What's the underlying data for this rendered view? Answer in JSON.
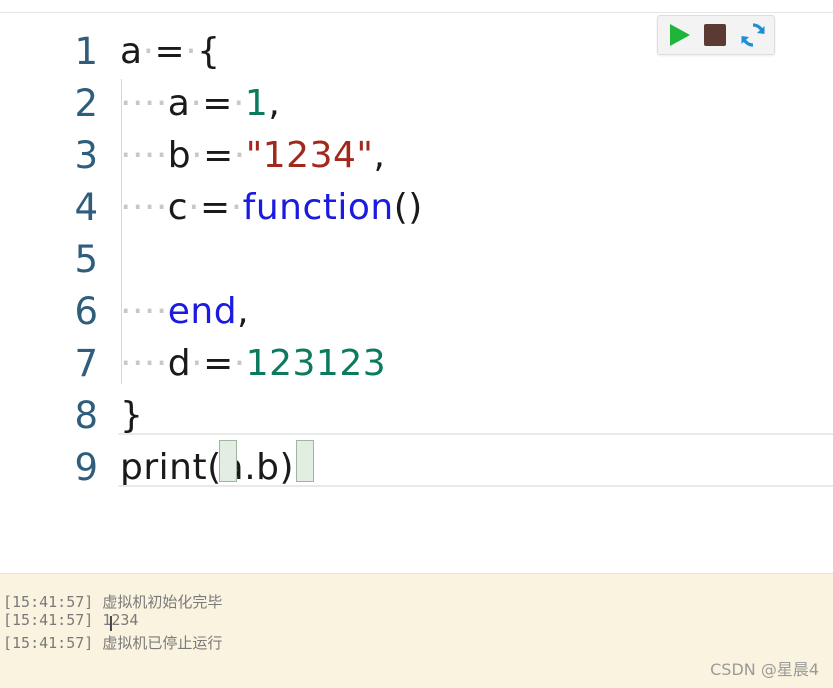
{
  "editor": {
    "line_numbers": [
      "1",
      "2",
      "3",
      "4",
      "5",
      "6",
      "7",
      "8",
      "9"
    ],
    "lines": [
      [
        {
          "t": "a",
          "c": ""
        },
        {
          "t": "·",
          "c": "ws"
        },
        {
          "t": "=",
          "c": ""
        },
        {
          "t": "·",
          "c": "ws"
        },
        {
          "t": "{",
          "c": ""
        }
      ],
      [
        {
          "t": "····",
          "c": "ws"
        },
        {
          "t": "a",
          "c": ""
        },
        {
          "t": "·",
          "c": "ws"
        },
        {
          "t": "=",
          "c": ""
        },
        {
          "t": "·",
          "c": "ws"
        },
        {
          "t": "1",
          "c": "num"
        },
        {
          "t": ",",
          "c": ""
        }
      ],
      [
        {
          "t": "····",
          "c": "ws"
        },
        {
          "t": "b",
          "c": ""
        },
        {
          "t": "·",
          "c": "ws"
        },
        {
          "t": "=",
          "c": ""
        },
        {
          "t": "·",
          "c": "ws"
        },
        {
          "t": "\"1234\"",
          "c": "str"
        },
        {
          "t": ",",
          "c": ""
        }
      ],
      [
        {
          "t": "····",
          "c": "ws"
        },
        {
          "t": "c",
          "c": ""
        },
        {
          "t": "·",
          "c": "ws"
        },
        {
          "t": "=",
          "c": ""
        },
        {
          "t": "·",
          "c": "ws"
        },
        {
          "t": "function",
          "c": "kw"
        },
        {
          "t": "()",
          "c": ""
        }
      ],
      [],
      [
        {
          "t": "····",
          "c": "ws"
        },
        {
          "t": "end",
          "c": "kw"
        },
        {
          "t": ",",
          "c": ""
        }
      ],
      [
        {
          "t": "····",
          "c": "ws"
        },
        {
          "t": "d",
          "c": ""
        },
        {
          "t": "·",
          "c": "ws"
        },
        {
          "t": "=",
          "c": ""
        },
        {
          "t": "·",
          "c": "ws"
        },
        {
          "t": "123123",
          "c": "num"
        }
      ],
      [
        {
          "t": "}",
          "c": ""
        }
      ],
      [
        {
          "t": "print",
          "c": ""
        },
        {
          "t": "(",
          "c": ""
        },
        {
          "t": "a.b",
          "c": ""
        },
        {
          "t": ")",
          "c": ""
        }
      ]
    ]
  },
  "toolbar": {
    "run_icon": "play-icon",
    "stop_icon": "stop-icon",
    "reload_icon": "reload-icon",
    "run_color": "#1fb53a",
    "stop_color": "#5a3a32",
    "reload_color": "#1e8fd6"
  },
  "console": {
    "logs": [
      "[15:41:57] 虚拟机初始化完毕",
      "[15:41:57] 1234",
      "[15:41:57] 虚拟机已停止运行"
    ]
  },
  "watermark": "CSDN @星晨4"
}
